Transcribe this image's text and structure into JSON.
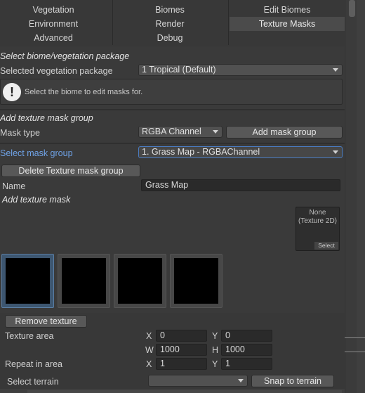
{
  "tabs": {
    "row1": [
      "Vegetation",
      "Biomes",
      "Edit Biomes"
    ],
    "row2": [
      "Environment",
      "Render",
      "Texture Masks"
    ],
    "row3": [
      "Advanced",
      "Debug"
    ],
    "active": "Texture Masks"
  },
  "biome_section": {
    "title": "Select biome/vegetation package",
    "package_label": "Selected vegetation package",
    "package_value": "1 Tropical (Default)",
    "help_text": "Select the biome to edit masks for.",
    "help_icon": "!"
  },
  "mask_group_section": {
    "title": "Add texture mask group",
    "mask_type_label": "Mask type",
    "mask_type_value": "RGBA Channel",
    "add_button": "Add mask group",
    "select_label": "Select mask group",
    "select_value": "1. Grass Map - RGBAChannel",
    "delete_button": "Delete Texture mask group",
    "name_label": "Name",
    "name_value": "Grass Map"
  },
  "texture_mask_section": {
    "title": "Add texture mask",
    "picker_line1": "None",
    "picker_line2": "(Texture 2D)",
    "picker_select": "Select",
    "thumbnails": [
      {
        "name": "mask-thumbnail-1",
        "selected": true
      },
      {
        "name": "mask-thumbnail-2",
        "selected": false
      },
      {
        "name": "mask-thumbnail-3",
        "selected": false
      },
      {
        "name": "mask-thumbnail-4",
        "selected": false
      }
    ]
  },
  "texture_settings": {
    "remove_button": "Remove texture",
    "area_label": "Texture area",
    "x_label": "X",
    "y_label": "Y",
    "w_label": "W",
    "h_label": "H",
    "area_x": "0",
    "area_y": "0",
    "area_w": "1000",
    "area_h": "1000",
    "repeat_label": "Repeat in area",
    "repeat_x": "1",
    "repeat_y": "1",
    "terrain_label": "Select terrain",
    "terrain_value": "",
    "snap_button": "Snap to terrain"
  }
}
